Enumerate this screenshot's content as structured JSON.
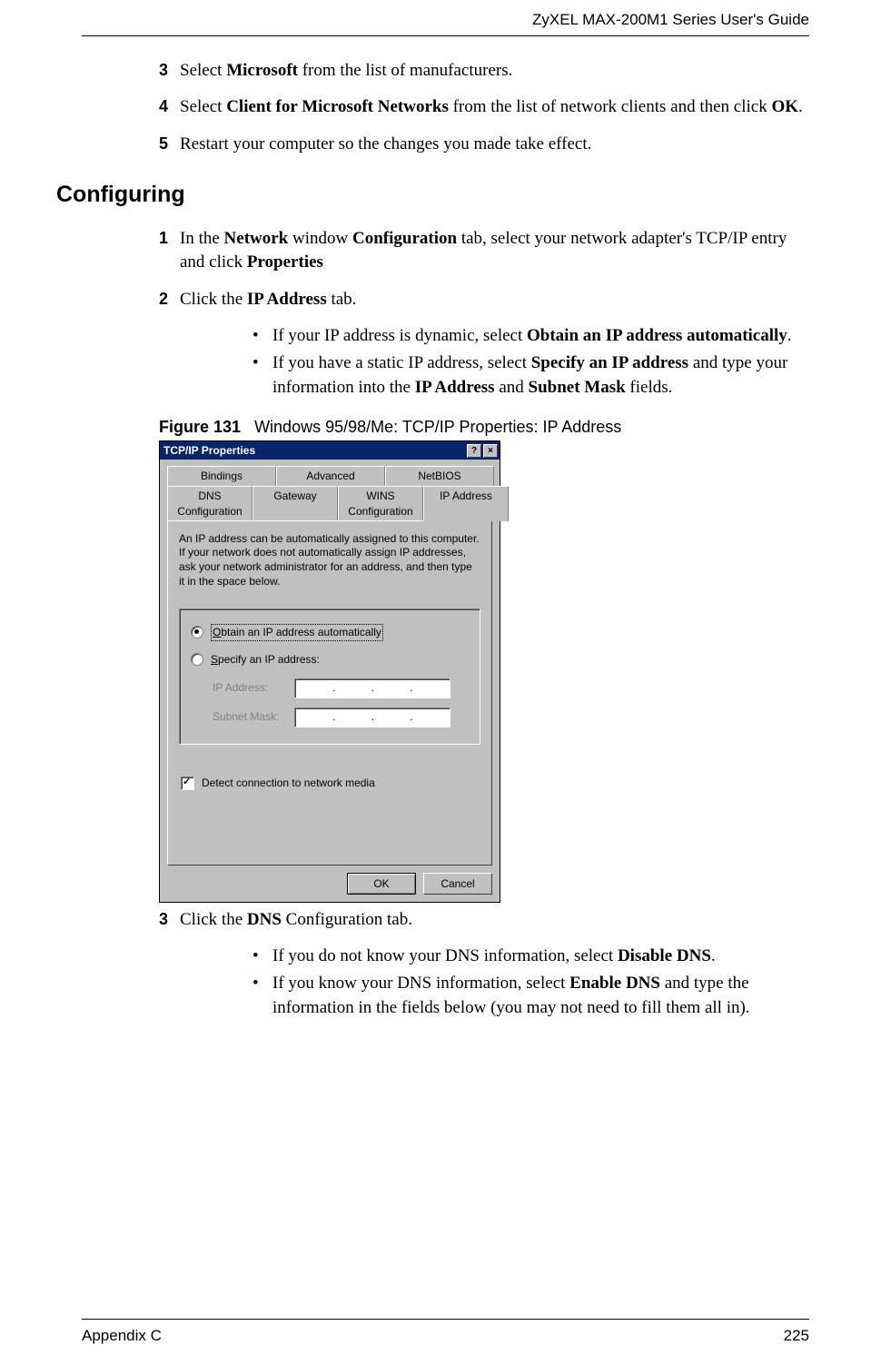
{
  "header": {
    "guide_title": "ZyXEL MAX-200M1 Series User's Guide"
  },
  "steps_top": [
    {
      "num": "3",
      "html": "Select <b>Microsoft</b> from the list of manufacturers."
    },
    {
      "num": "4",
      "html": "Select <b>Client for Microsoft Networks</b> from the list of network clients and then click <b>OK</b>."
    },
    {
      "num": "5",
      "html": "Restart your computer so the changes you made take effect."
    }
  ],
  "section_heading": "Configuring",
  "steps_config": [
    {
      "num": "1",
      "html": "In the <b>Network</b> window <b>Configuration</b> tab, select your network adapter's TCP/IP entry and click <b>Properties</b>"
    },
    {
      "num": "2",
      "html": "Click the <b>IP Address</b> tab."
    }
  ],
  "bullets_ip": [
    "If your IP address is dynamic, select <b>Obtain an IP address automatically</b>.",
    "If you have a static IP address, select <b>Specify an IP address</b> and type your information into the <b>IP Address</b> and <b>Subnet Mask</b> fields."
  ],
  "figure": {
    "label": "Figure 131",
    "caption": "Windows 95/98/Me: TCP/IP Properties: IP Address"
  },
  "dialog": {
    "title": "TCP/IP Properties",
    "tabs_row1": [
      "Bindings",
      "Advanced",
      "NetBIOS"
    ],
    "tabs_row2": [
      "DNS Configuration",
      "Gateway",
      "WINS Configuration",
      "IP Address"
    ],
    "active_tab": "IP Address",
    "help_text": "An IP address can be automatically assigned to this computer. If your network does not automatically assign IP addresses, ask your network administrator for an address, and then type it in the space below.",
    "radio_obtain": "Obtain an IP address automatically",
    "radio_specify": "Specify an IP address:",
    "field_ip": "IP Address:",
    "field_mask": "Subnet Mask:",
    "checkbox_detect": "Detect connection to network media",
    "btn_ok": "OK",
    "btn_cancel": "Cancel"
  },
  "steps_after": [
    {
      "num": "3",
      "html": "Click the <b>DNS</b> Configuration tab."
    }
  ],
  "bullets_dns": [
    "If you do not know your DNS information, select <b>Disable DNS</b>.",
    "If you know your DNS information, select <b>Enable DNS</b> and type the information in the fields below (you may not need to fill them all in)."
  ],
  "footer": {
    "left": "Appendix C",
    "right": "225"
  }
}
